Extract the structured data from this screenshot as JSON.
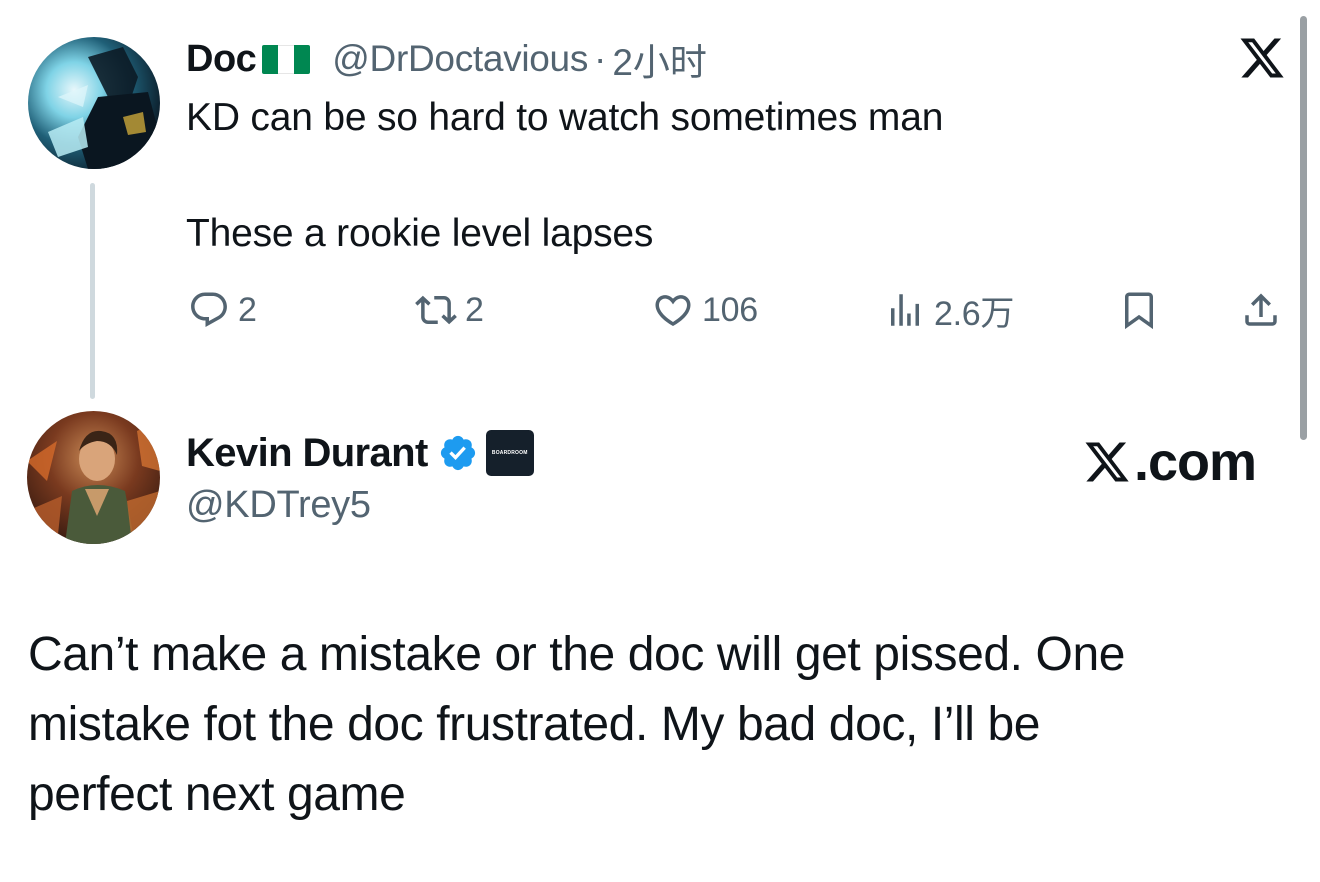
{
  "parent_tweet": {
    "display_name": "Doc",
    "flag": "nigeria-flag",
    "handle": "@DrDoctavious",
    "separator": "·",
    "time": "2小时",
    "text_line1": "KD can be so hard to watch sometimes man",
    "text_line2": "These a rookie level lapses",
    "actions": {
      "replies": "2",
      "retweets": "2",
      "likes": "106",
      "views": "2.6万"
    }
  },
  "reply_tweet": {
    "display_name": "Kevin Durant",
    "badge": "BOARDROOM",
    "handle": "@KDTrey5",
    "brand": ".com",
    "text_lines": [
      "Can’t make a mistake or the doc will get pissed. One",
      "mistake fot the doc frustrated. My bad doc, I’ll be",
      "perfect next game"
    ]
  },
  "colors": {
    "text": "#0f1419",
    "secondary": "#536471",
    "verified_blue": "#1d9bf0",
    "thread_line": "#cfd9de",
    "nigeria_green": "#008751"
  },
  "icons": [
    "reply-icon",
    "retweet-icon",
    "like-icon",
    "views-icon",
    "bookmark-icon",
    "share-icon",
    "x-logo-icon",
    "verified-badge-icon"
  ]
}
